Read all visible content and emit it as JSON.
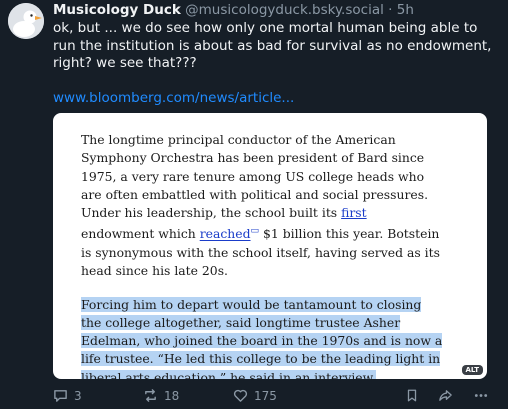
{
  "post": {
    "author_name": "Musicology Duck",
    "author_handle": "@musicologyduck.bsky.social",
    "separator": "·",
    "time": "5h",
    "text": "ok, but ... we do see how only one mortal human being able to run the institution is about as bad for survival as no endowment, right? we see that???",
    "link_text": "www.bloomberg.com/news/article..."
  },
  "image": {
    "alt_badge": "ALT",
    "p1": {
      "before_first": "The longtime principal conductor of the American Symphony Orchestra has been president of Bard since 1975, a very rare tenure among US college heads who are often embattled with political and social pressures. Under his leadership, the school built its ",
      "first": "first",
      "after_first": " endowment which ",
      "reached": "reached",
      "after_reached": " $1 billion this year. Botstein is synonymous with the school itself, having served as its head since his late 20s."
    },
    "p2": "Forcing him to depart would be tantamount to closing the college altogether, said longtime trustee Asher Edelman, who joined the board in the 1970s and is now a life trustee. “He led this college to be the leading light in liberal arts education,” he said in an interview."
  },
  "actions": {
    "replies": "3",
    "reposts": "18",
    "likes": "175"
  },
  "icons": {
    "avatar": "duck-avatar",
    "reply": "reply-icon",
    "repost": "repost-icon",
    "like": "heart-icon",
    "bookmark": "bookmark-icon",
    "share": "share-icon",
    "more": "more-icon"
  }
}
